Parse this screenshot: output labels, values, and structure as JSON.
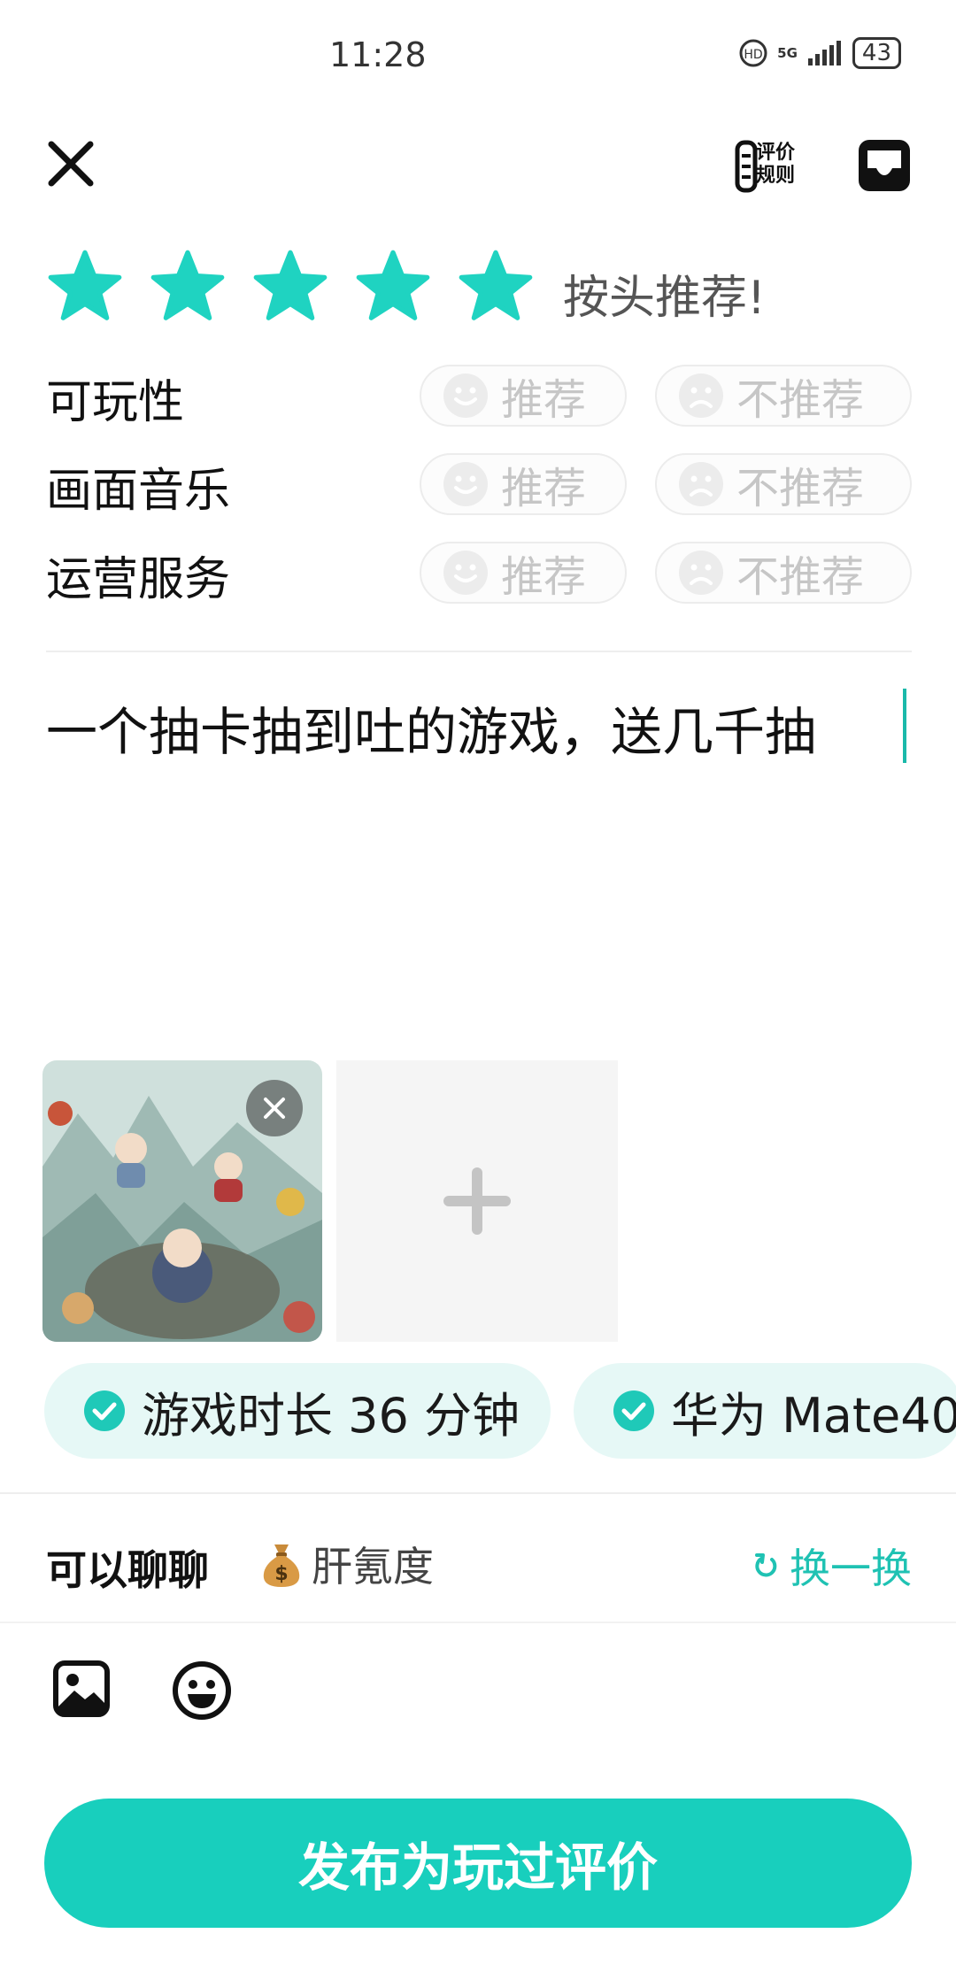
{
  "status_bar": {
    "time": "11:28",
    "network": "5G",
    "battery": "43"
  },
  "top_bar": {
    "rules_label_line1": "评价",
    "rules_label_line2": "规则"
  },
  "rating": {
    "stars": 5,
    "max_stars": 5,
    "label": "按头推荐!",
    "star_color": "#1fd3c1"
  },
  "criteria": [
    {
      "label": "可玩性",
      "recommend": "推荐",
      "not_recommend": "不推荐"
    },
    {
      "label": "画面音乐",
      "recommend": "推荐",
      "not_recommend": "不推荐"
    },
    {
      "label": "运营服务",
      "recommend": "推荐",
      "not_recommend": "不推荐"
    }
  ],
  "review": {
    "text": "一个抽卡抽到吐的游戏，送几千抽"
  },
  "tags": [
    {
      "label": "游戏时长 36 分钟"
    },
    {
      "label": "华为 Mate40"
    }
  ],
  "chat": {
    "label": "可以聊聊",
    "topic": "肝氪度",
    "topic_icon": "money-bag-icon",
    "shuffle": "换一换"
  },
  "publish": {
    "label": "发布为玩过评价"
  },
  "colors": {
    "accent": "#18cfbd",
    "tag_bg": "#e6f8f6"
  }
}
